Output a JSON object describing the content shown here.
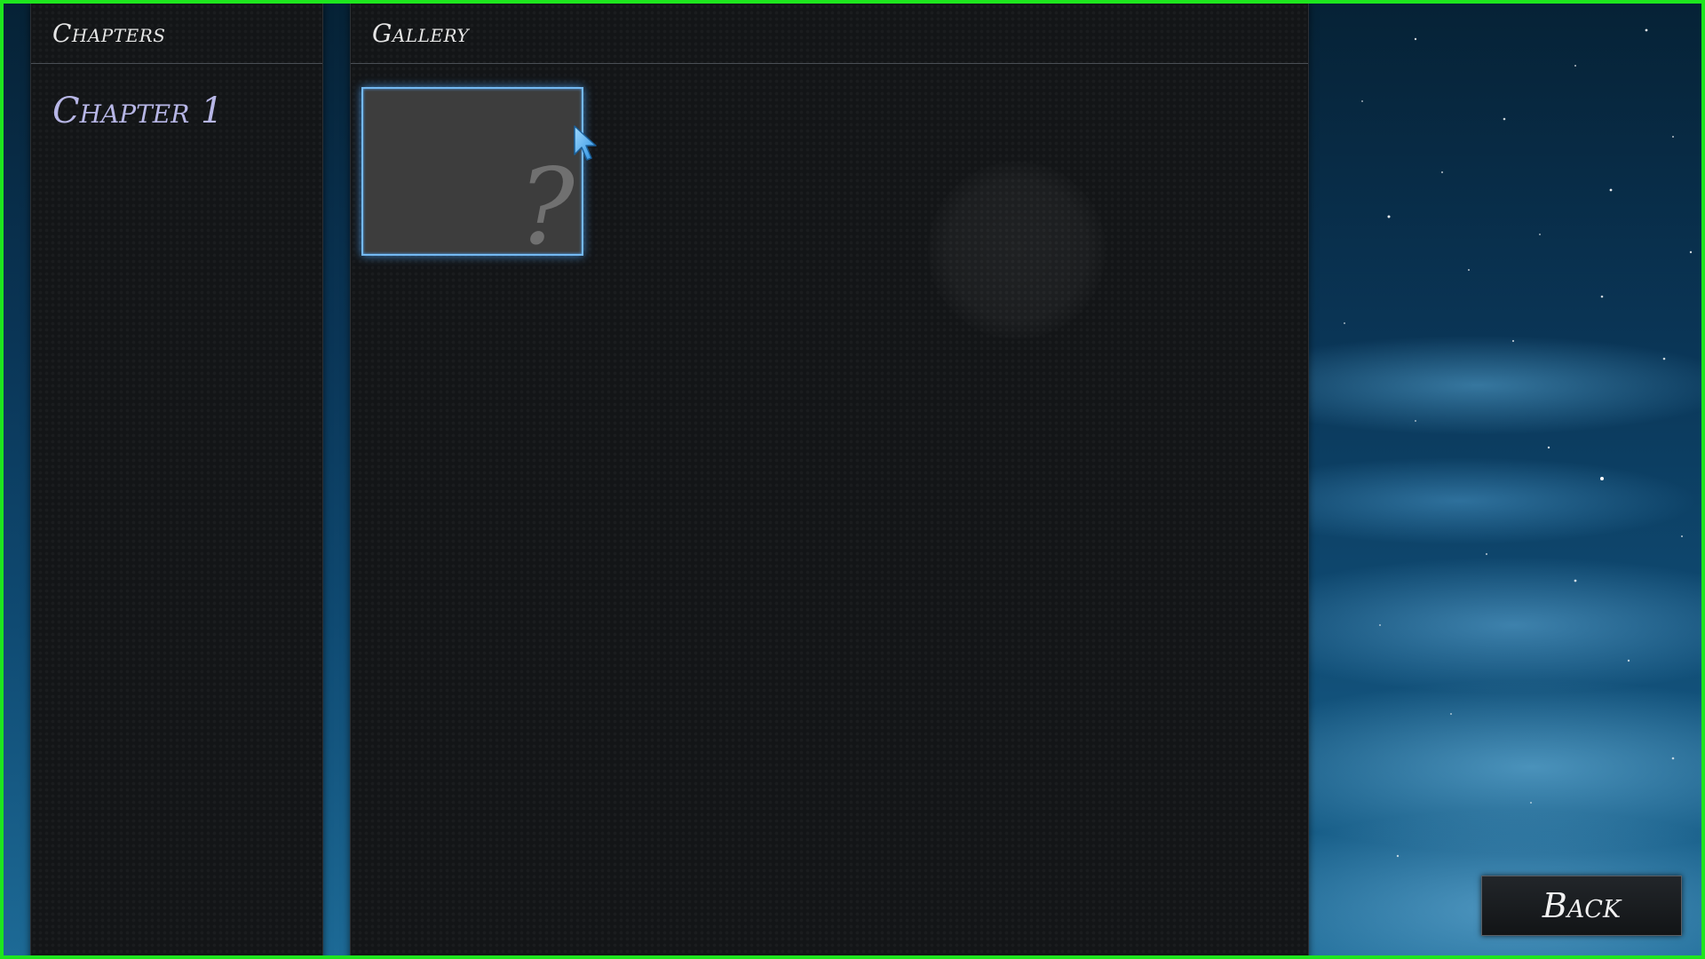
{
  "chapters_panel": {
    "title": "Chapters",
    "items": [
      {
        "label": "Chapter 1"
      }
    ]
  },
  "gallery_panel": {
    "title": "Gallery",
    "thumbnails": [
      {
        "state": "locked",
        "placeholder": "?",
        "selected": true
      }
    ]
  },
  "back_button": {
    "label": "Back"
  },
  "colors": {
    "frame_border": "#1ee61e",
    "chapter_text": "#b7b6e6",
    "selection_glow": "#74b9f2",
    "panel_bg": "#131517"
  },
  "icons": {
    "locked_placeholder": "question-mark-icon",
    "pointer": "mouse-cursor-icon"
  }
}
